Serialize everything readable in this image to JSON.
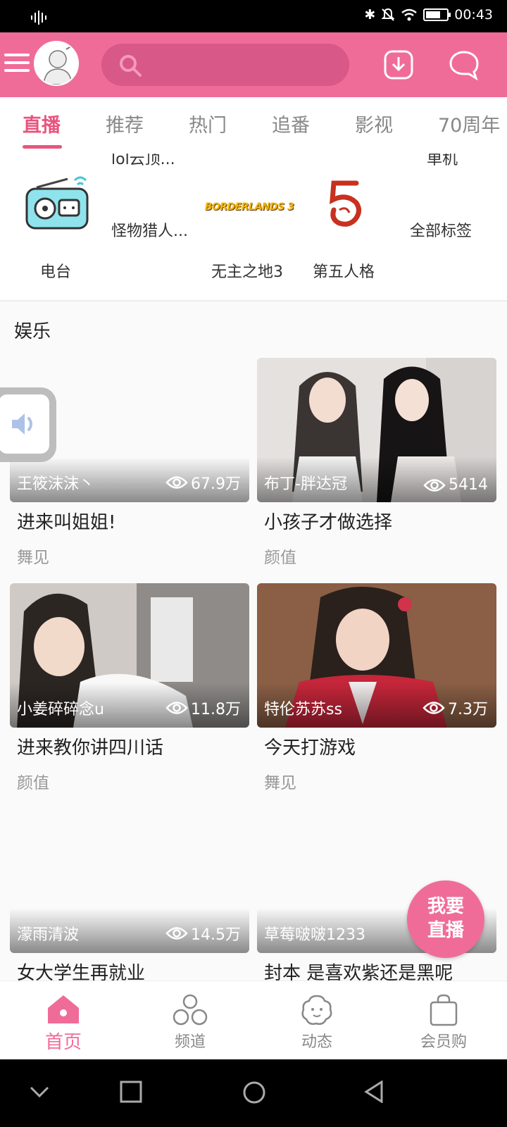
{
  "status_bar": {
    "time": "00:43"
  },
  "header": {
    "search_placeholder": ""
  },
  "tabs": [
    {
      "label": "直播"
    },
    {
      "label": "推荐"
    },
    {
      "label": "热门"
    },
    {
      "label": "追番"
    },
    {
      "label": "影视"
    },
    {
      "label": "70周年"
    }
  ],
  "categories": {
    "cut_top": [
      "lol云顶...",
      "单机"
    ],
    "items": [
      {
        "label": "电台"
      },
      {
        "label": "怪物猎人..."
      },
      {
        "label": "无主之地3"
      },
      {
        "label": "第五人格"
      },
      {
        "label": "全部标签"
      }
    ],
    "borderlands_logo": "BORDERLANDS 3"
  },
  "section": {
    "title": "娱乐"
  },
  "cards": [
    {
      "streamer": "王筱沫沫丶",
      "views": "67.9万",
      "title": "进来叫姐姐!",
      "category": "舞见"
    },
    {
      "streamer": "布丁-胖达冠",
      "views": "5414",
      "title": "小孩子才做选择",
      "category": "颜值"
    },
    {
      "streamer": "小姜碎碎念u",
      "views": "11.8万",
      "title": "进来教你讲四川话",
      "category": "颜值"
    },
    {
      "streamer": "特伦苏苏ss",
      "views": "7.3万",
      "title": "今天打游戏",
      "category": "舞见"
    },
    {
      "streamer": "濛雨清波",
      "views": "14.5万",
      "title": "女大学生再就业",
      "category": ""
    },
    {
      "streamer": "草莓啵啵1233",
      "views": "",
      "title": "封本 是喜欢紫还是黑呢",
      "category": ""
    }
  ],
  "fab": {
    "line1": "我要",
    "line2": "直播"
  },
  "bottom_nav": [
    {
      "label": "首页",
      "icon": "home-icon"
    },
    {
      "label": "频道",
      "icon": "channel-icon"
    },
    {
      "label": "动态",
      "icon": "feed-icon"
    },
    {
      "label": "会员购",
      "icon": "shopping-bag-icon"
    }
  ],
  "colors": {
    "brand": "#f06c98",
    "active_tab": "#e8557f"
  }
}
